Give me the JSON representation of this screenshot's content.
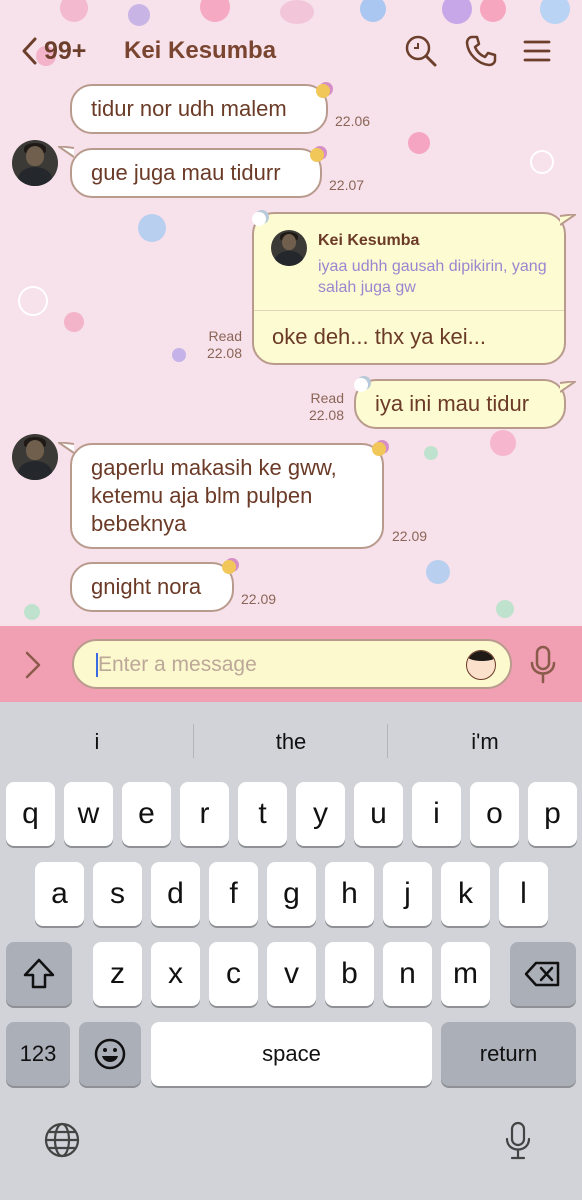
{
  "header": {
    "unread_count": "99+",
    "contact_name": "Kei Kesumba"
  },
  "messages": [
    {
      "id": "m1",
      "text": "tidur nor udh malem",
      "time": "22.06"
    },
    {
      "id": "m2",
      "text": "gue juga mau tidurr",
      "time": "22.07"
    },
    {
      "id": "m3",
      "quote_name": "Kei Kesumba",
      "quote_text": "iyaa udhh gausah dipikirin, yang salah juga gw",
      "text": "oke deh... thx ya kei...",
      "read": "Read",
      "time": "22.08"
    },
    {
      "id": "m4",
      "text": "iya ini mau tidur",
      "read": "Read",
      "time": "22.08"
    },
    {
      "id": "m5",
      "text": "gaperlu makasih ke gww, ketemu aja blm pulpen bebeknya",
      "time": "22.09"
    },
    {
      "id": "m6",
      "text": "gnight nora",
      "time": "22.09"
    }
  ],
  "input": {
    "placeholder": "Enter a message"
  },
  "keyboard": {
    "suggestions": [
      "i",
      "the",
      "i'm"
    ],
    "row1": [
      "q",
      "w",
      "e",
      "r",
      "t",
      "y",
      "u",
      "i",
      "o",
      "p"
    ],
    "row2": [
      "a",
      "s",
      "d",
      "f",
      "g",
      "h",
      "j",
      "k",
      "l"
    ],
    "row3": [
      "z",
      "x",
      "c",
      "v",
      "b",
      "n",
      "m"
    ],
    "numbers_label": "123",
    "space_label": "space",
    "return_label": "return"
  },
  "colors": {
    "chat_background": "#f7e1ea",
    "input_bar": "#f0a0b2",
    "bubble_outgoing": "#fdfbd2",
    "bubble_incoming": "#ffffff",
    "bubble_text": "#6b3b28",
    "quote_text": "#9a86d0"
  }
}
